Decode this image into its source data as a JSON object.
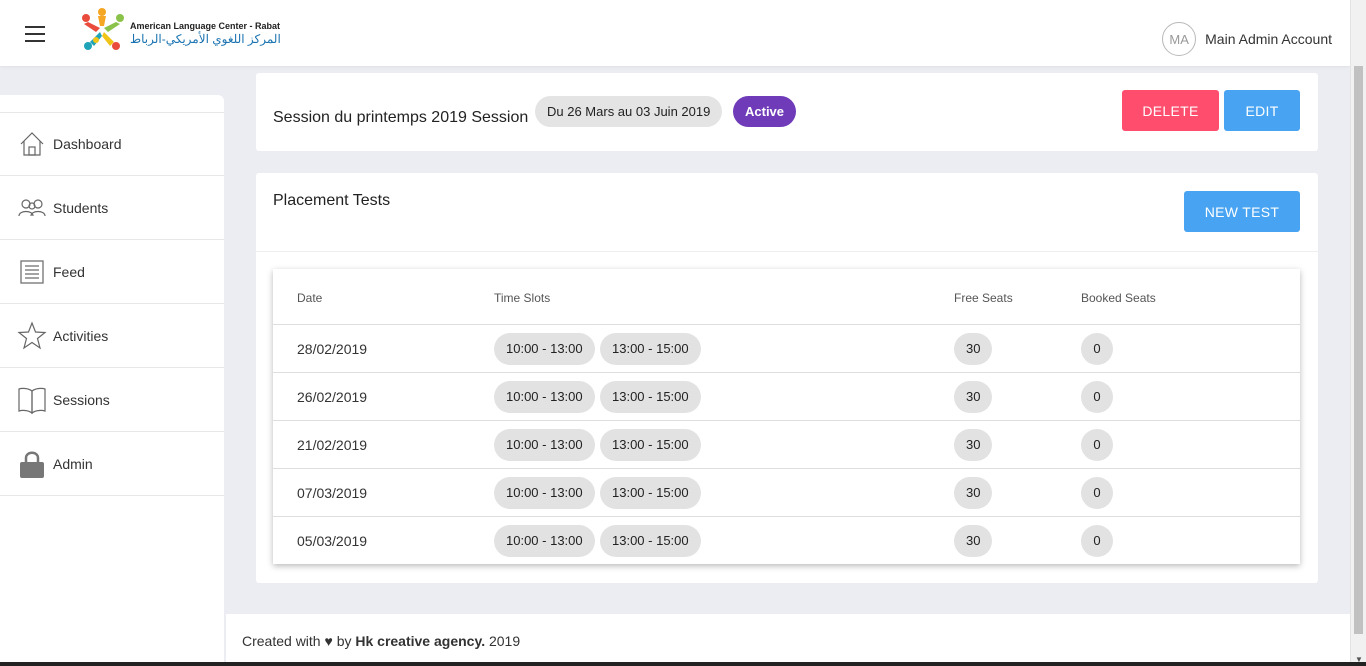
{
  "header": {
    "logo_text_en": "American Language Center - Rabat",
    "logo_text_ar": "المركز اللغوي الأمريكي-الرباط",
    "avatar_initials": "MA",
    "user_name": "Main Admin Account"
  },
  "sidebar": {
    "items": [
      {
        "label": "Dashboard",
        "icon": "home-icon"
      },
      {
        "label": "Students",
        "icon": "users-icon"
      },
      {
        "label": "Feed",
        "icon": "newspaper-icon"
      },
      {
        "label": "Activities",
        "icon": "star-icon"
      },
      {
        "label": "Sessions",
        "icon": "book-icon"
      },
      {
        "label": "Admin",
        "icon": "lock-icon"
      }
    ]
  },
  "session": {
    "title": "Session du printemps 2019 Session",
    "date_range": "Du 26 Mars au 03 Juin 2019",
    "status": "Active",
    "delete_label": "DELETE",
    "edit_label": "EDIT"
  },
  "tests": {
    "title": "Placement Tests",
    "new_test_label": "NEW TEST",
    "columns": {
      "date": "Date",
      "time_slots": "Time Slots",
      "free_seats": "Free Seats",
      "booked_seats": "Booked Seats"
    },
    "rows": [
      {
        "date": "28/02/2019",
        "slots": [
          "10:00 - 13:00",
          "13:00 - 15:00"
        ],
        "free": "30",
        "booked": "0"
      },
      {
        "date": "26/02/2019",
        "slots": [
          "10:00 - 13:00",
          "13:00 - 15:00"
        ],
        "free": "30",
        "booked": "0"
      },
      {
        "date": "21/02/2019",
        "slots": [
          "10:00 - 13:00",
          "13:00 - 15:00"
        ],
        "free": "30",
        "booked": "0"
      },
      {
        "date": "07/03/2019",
        "slots": [
          "10:00 - 13:00",
          "13:00 - 15:00"
        ],
        "free": "30",
        "booked": "0"
      },
      {
        "date": "05/03/2019",
        "slots": [
          "10:00 - 13:00",
          "13:00 - 15:00"
        ],
        "free": "30",
        "booked": "0"
      }
    ]
  },
  "footer": {
    "prefix": "Created with",
    "heart": "♥",
    "by": "by",
    "agency": "Hk creative agency.",
    "year": "2019"
  },
  "colors": {
    "delete": "#ff4d6d",
    "primary": "#48a4f2",
    "active_badge": "#6f3bb8",
    "background": "#ebedf2"
  }
}
